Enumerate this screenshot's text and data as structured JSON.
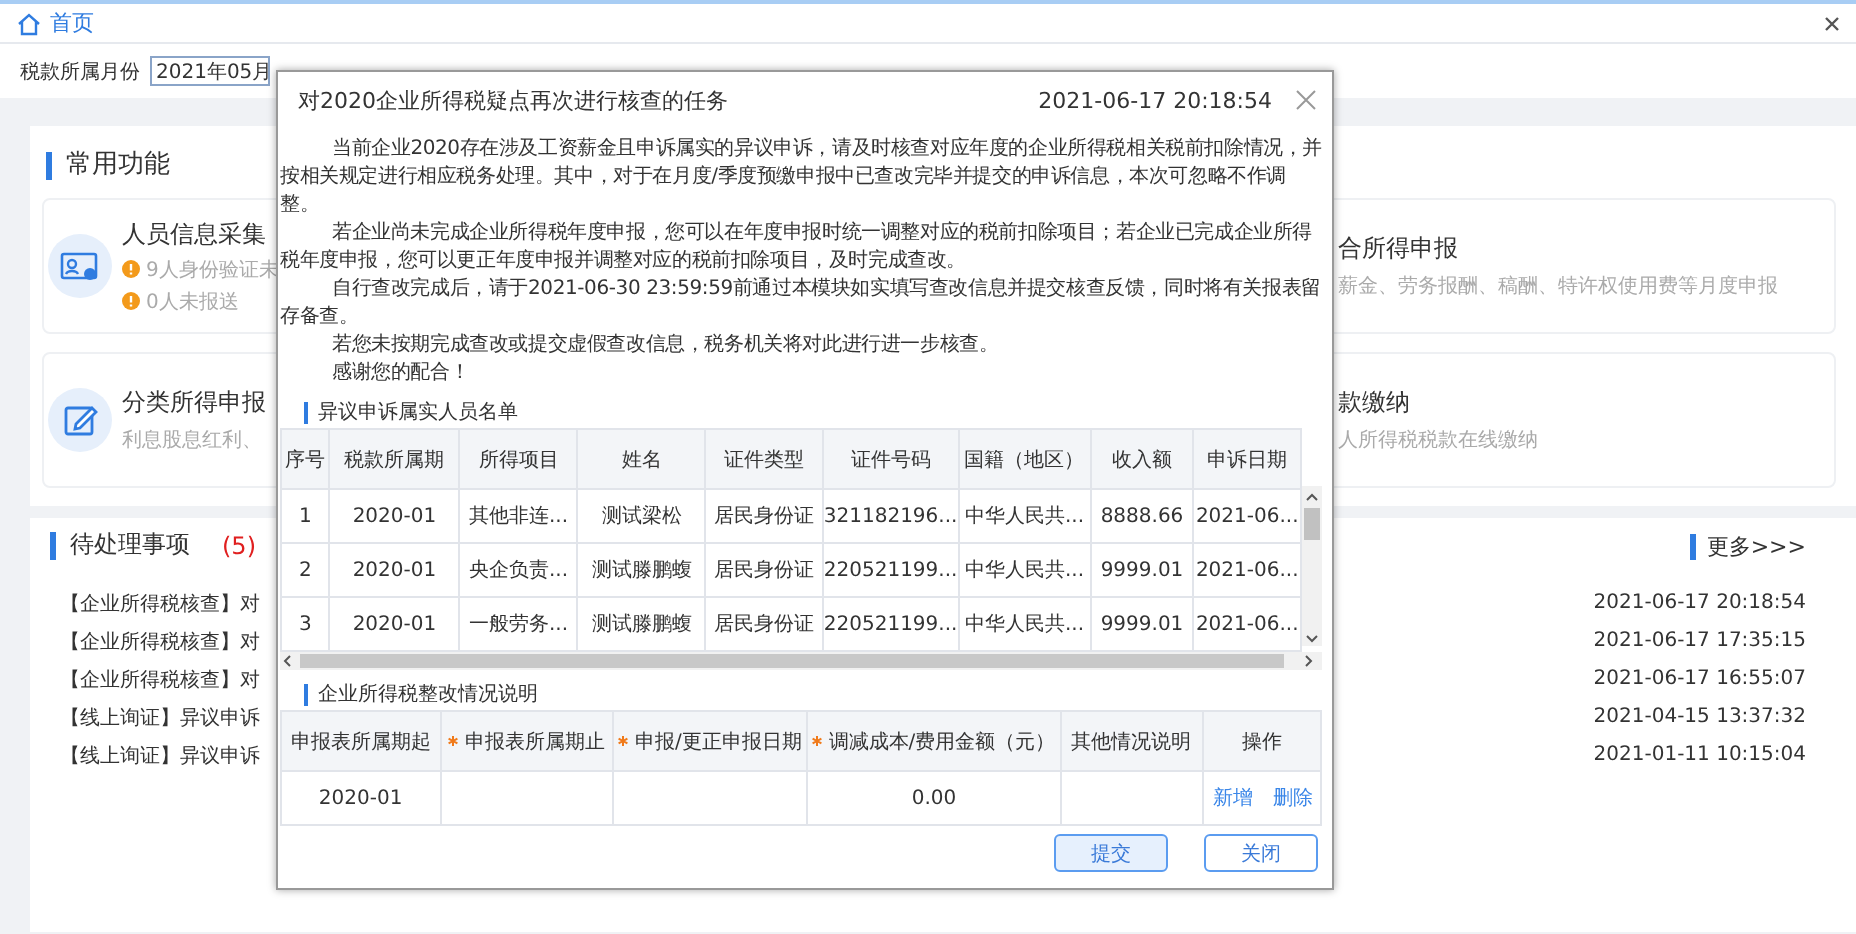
{
  "header": {
    "home_link": "首页"
  },
  "filter": {
    "label": "税款所属月份",
    "value": "2021年05月"
  },
  "functions": {
    "title": "常用功能",
    "cards": [
      {
        "kind": "id-card",
        "title": "人员信息采集",
        "notes": [
          "9人身份验证未",
          "0人未报送"
        ]
      },
      {
        "kind": "plain",
        "title": "合所得申报",
        "desc": "薪金、劳务报酬、稿酬、特许权使用费等月度申报"
      },
      {
        "kind": "pen",
        "title": "分类所得申报",
        "desc": "利息股息红利、"
      },
      {
        "kind": "plain",
        "title": "款缴纳",
        "desc": "人所得税税款在线缴纳"
      }
    ]
  },
  "todo": {
    "title": "待处理事项",
    "count": "(5)",
    "more": "更多>>>",
    "items": [
      {
        "text": "【企业所得税核查】对",
        "time": "2021-06-17 20:18:54"
      },
      {
        "text": "【企业所得税核查】对",
        "time": "2021-06-17 17:35:15"
      },
      {
        "text": "【企业所得税核查】对",
        "time": "2021-06-17 16:55:07"
      },
      {
        "text": "【线上询证】异议申诉",
        "time": "2021-04-15 13:37:32"
      },
      {
        "text": "【线上询证】异议申诉",
        "time": "2021-01-11 10:15:04"
      }
    ]
  },
  "dialog": {
    "title": "对2020企业所得税疑点再次进行核查的任务",
    "time": "2021-06-17 20:18:54",
    "paragraphs": [
      "当前企业2020存在涉及工资薪金且申诉属实的异议申诉，请及时核查对应年度的企业所得税相关税前扣除情况，并按相关规定进行相应税务处理。其中，对于在月度/季度预缴申报中已查改完毕并提交的申诉信息，本次可忽略不作调整。",
      "若企业尚未完成企业所得税年度申报，您可以在年度申报时统一调整对应的税前扣除项目；若企业已完成企业所得税年度申报，您可以更正年度申报并调整对应的税前扣除项目，及时完成查改。",
      "自行查改完成后，请于2021-06-30 23:59:59前通过本模块如实填写查改信息并提交核查反馈，同时将有关报表留存备查。",
      "若您未按期完成查改或提交虚假查改信息，税务机关将对此进行进一步核查。",
      "感谢您的配合！"
    ],
    "people_table": {
      "title": "异议申诉属实人员名单",
      "columns": [
        "序号",
        "税款所属期",
        "所得项目",
        "姓名",
        "证件类型",
        "证件号码",
        "国籍（地区）",
        "收入额",
        "申诉日期"
      ],
      "rows": [
        [
          "1",
          "2020-01",
          "其他非连...",
          "测试梁松",
          "居民身份证",
          "321182196...",
          "中华人民共...",
          "8888.66",
          "2021-06..."
        ],
        [
          "2",
          "2020-01",
          "央企负责...",
          "测试滕鹏蝮",
          "居民身份证",
          "220521199...",
          "中华人民共...",
          "9999.01",
          "2021-06..."
        ],
        [
          "3",
          "2020-01",
          "一般劳务...",
          "测试滕鹏蝮",
          "居民身份证",
          "220521199...",
          "中华人民共...",
          "9999.01",
          "2021-06..."
        ]
      ]
    },
    "rectify_table": {
      "title": "企业所得税整改情况说明",
      "columns": [
        {
          "label": "申报表所属期起",
          "required": false
        },
        {
          "label": "申报表所属期止",
          "required": true
        },
        {
          "label": "申报/更正申报日期",
          "required": true
        },
        {
          "label": "调减成本/费用金额（元）",
          "required": true
        },
        {
          "label": "其他情况说明",
          "required": false
        },
        {
          "label": "操作",
          "required": false
        }
      ],
      "rows": [
        {
          "cells": [
            "2020-01",
            null,
            null,
            "0.00",
            null
          ],
          "actions": [
            "新增",
            "删除"
          ]
        }
      ]
    },
    "buttons": [
      {
        "label": "提交",
        "kind": "primary"
      },
      {
        "label": "关闭",
        "kind": "default"
      }
    ]
  }
}
